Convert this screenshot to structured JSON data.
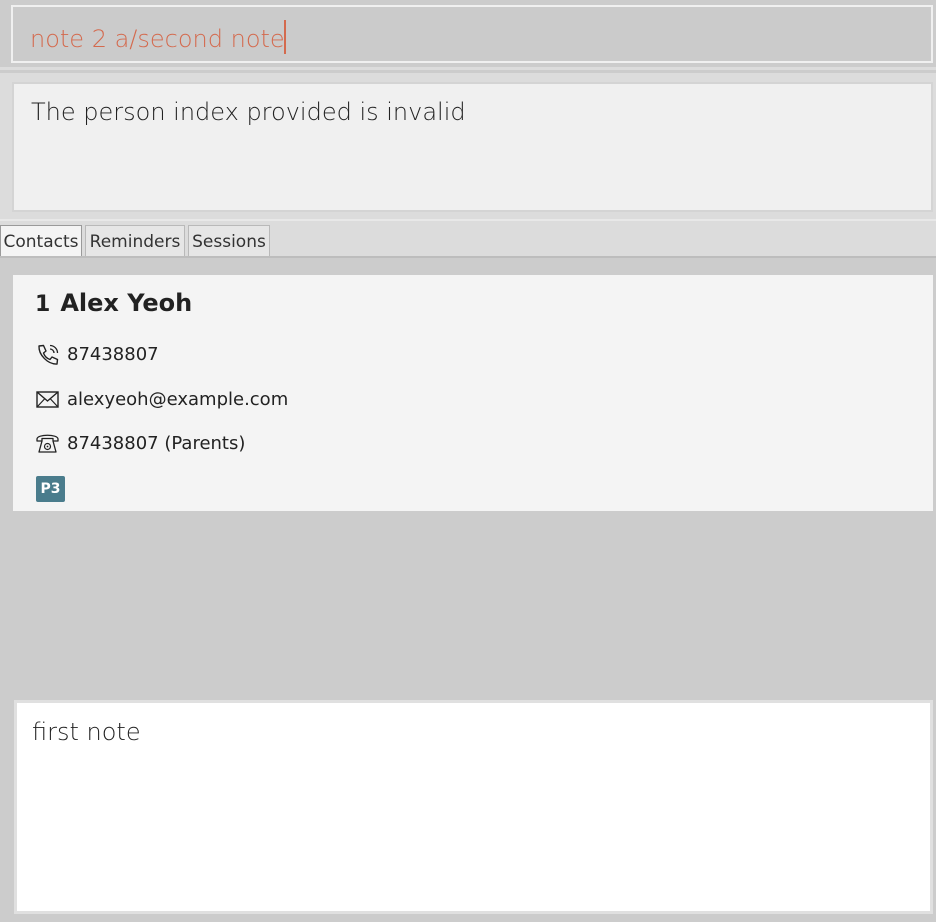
{
  "command": {
    "value": "note 2 a/second note"
  },
  "result": {
    "message": "The person index provided is invalid"
  },
  "tabs": [
    {
      "label": "Contacts",
      "active": true
    },
    {
      "label": "Reminders",
      "active": false
    },
    {
      "label": "Sessions",
      "active": false
    }
  ],
  "persons": [
    {
      "index": "1",
      "name": "Alex Yeoh",
      "phone": "87438807",
      "email": "alexyeoh@example.com",
      "parent_phone": "87438807 (Parents)",
      "tags": [
        "P3"
      ],
      "icons": {
        "phone": "phone-icon",
        "email": "envelope-icon",
        "parent_phone": "telephone-icon"
      }
    }
  ],
  "notes": {
    "text": "first note"
  },
  "colors": {
    "command_text": "#d46a4e",
    "tag_background": "#4a7c8c",
    "background": "#cccccc"
  }
}
